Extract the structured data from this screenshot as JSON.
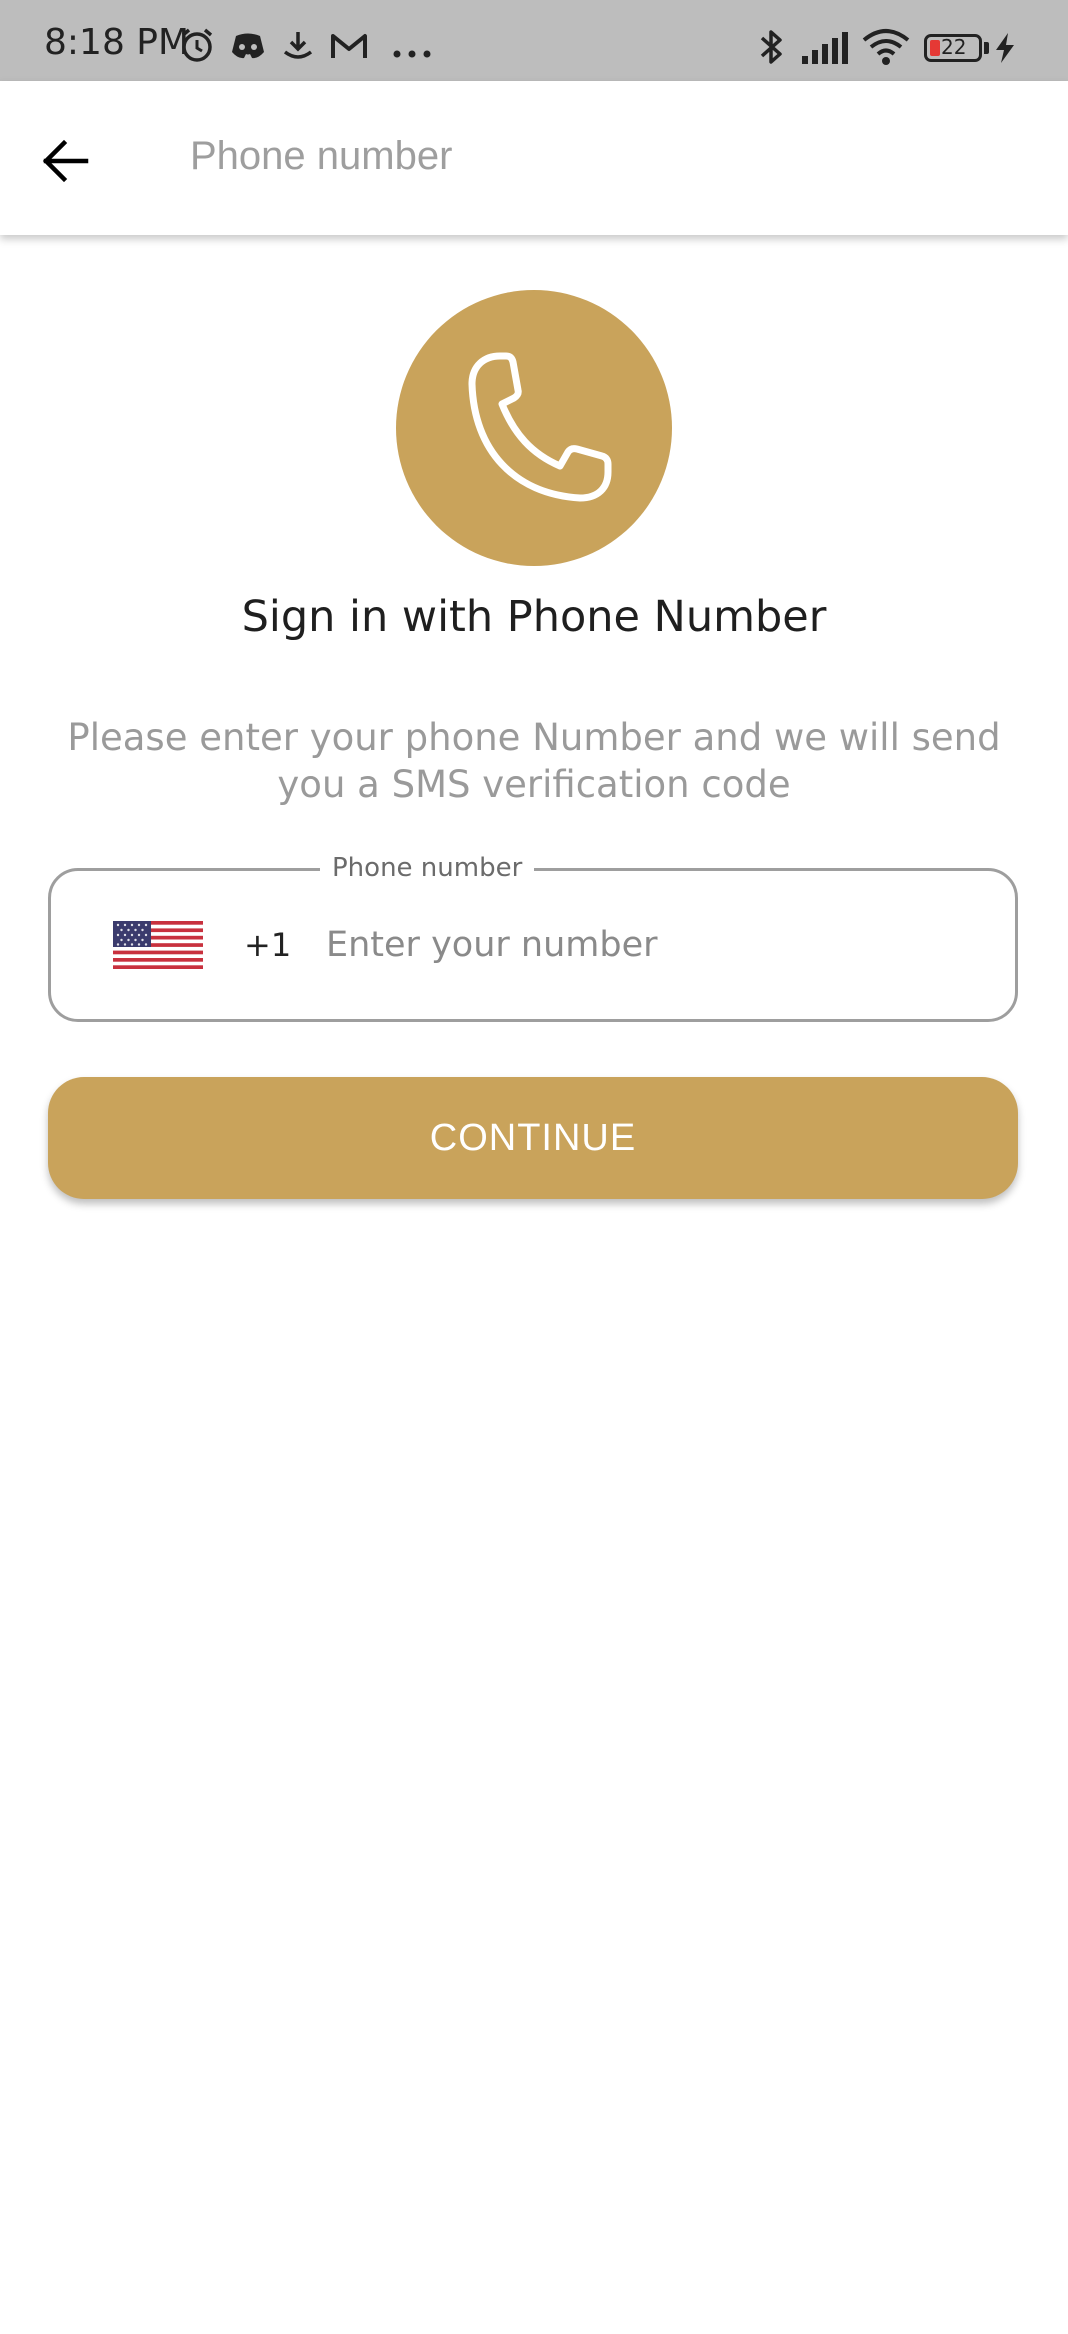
{
  "status_bar": {
    "time": "8:18 PM",
    "battery_level": "22",
    "icons": [
      "alarm-icon",
      "discord-icon",
      "download-icon",
      "gmail-icon",
      "more-dots-icon",
      "bluetooth-icon",
      "signal-icon",
      "wifi-icon",
      "battery-icon",
      "charging-icon"
    ]
  },
  "app_bar": {
    "title": "Phone number",
    "back_icon": "arrow-left-icon"
  },
  "content": {
    "heading": "Sign in with Phone Number",
    "subtitle": "Please enter your phone Number and we will send you a SMS verification code",
    "phone_field": {
      "label": "Phone number",
      "country_flag": "us-flag-icon",
      "dial_code": "+1",
      "placeholder": "Enter your number",
      "value": ""
    },
    "continue_label": "CONTINUE"
  },
  "colors": {
    "accent": "#c9a35b",
    "status_bar": "#bdbdbd",
    "placeholder": "#8a8a8a"
  }
}
